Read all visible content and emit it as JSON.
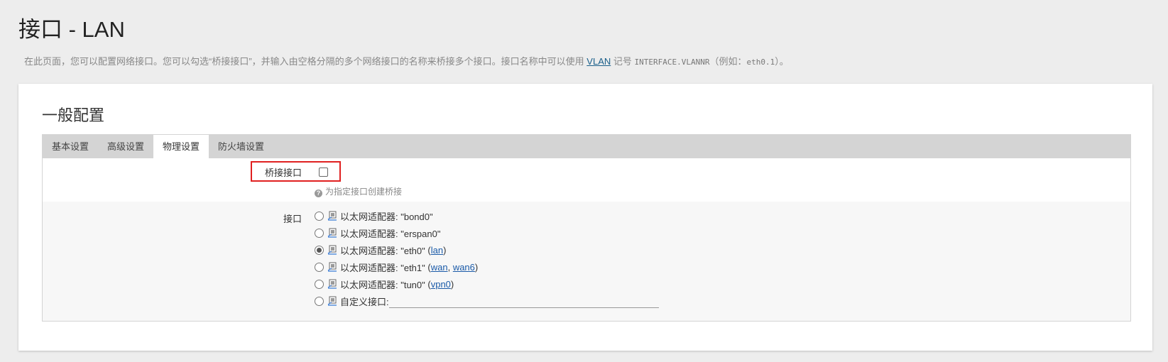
{
  "page": {
    "title": "接口 - LAN",
    "desc_before": "在此页面，您可以配置网络接口。您可以勾选“桥接接口”，并输入由空格分隔的多个网络接口的名称来桥接多个接口。接口名称中可以使用",
    "desc_link": "VLAN",
    "desc_mid": "记号",
    "desc_code": "INTERFACE.VLANNR",
    "desc_after": "（例如：",
    "desc_code2": "eth0.1",
    "desc_end": "）。"
  },
  "section": {
    "title": "一般配置",
    "tabs": [
      {
        "label": "基本设置",
        "active": false
      },
      {
        "label": "高级设置",
        "active": false
      },
      {
        "label": "物理设置",
        "active": true
      },
      {
        "label": "防火墙设置",
        "active": false
      }
    ]
  },
  "bridge": {
    "label": "桥接接口",
    "checked": false,
    "hint": "为指定接口创建桥接"
  },
  "interface": {
    "label": "接口",
    "options": [
      {
        "prefix": "以太网适配器: \"bond0\"",
        "links": [],
        "checked": false
      },
      {
        "prefix": "以太网适配器: \"erspan0\"",
        "links": [],
        "checked": false
      },
      {
        "prefix": "以太网适配器: \"eth0\"",
        "links": [
          "lan"
        ],
        "checked": true
      },
      {
        "prefix": "以太网适配器: \"eth1\"",
        "links": [
          "wan",
          "wan6"
        ],
        "checked": false
      },
      {
        "prefix": "以太网适配器: \"tun0\"",
        "links": [
          "vpn0"
        ],
        "checked": false
      }
    ],
    "custom_label": "自定义接口:",
    "custom_value": ""
  },
  "colors": {
    "highlight": "#e02020",
    "link": "#1a5aa8",
    "tabbar": "#d4d4d4"
  }
}
